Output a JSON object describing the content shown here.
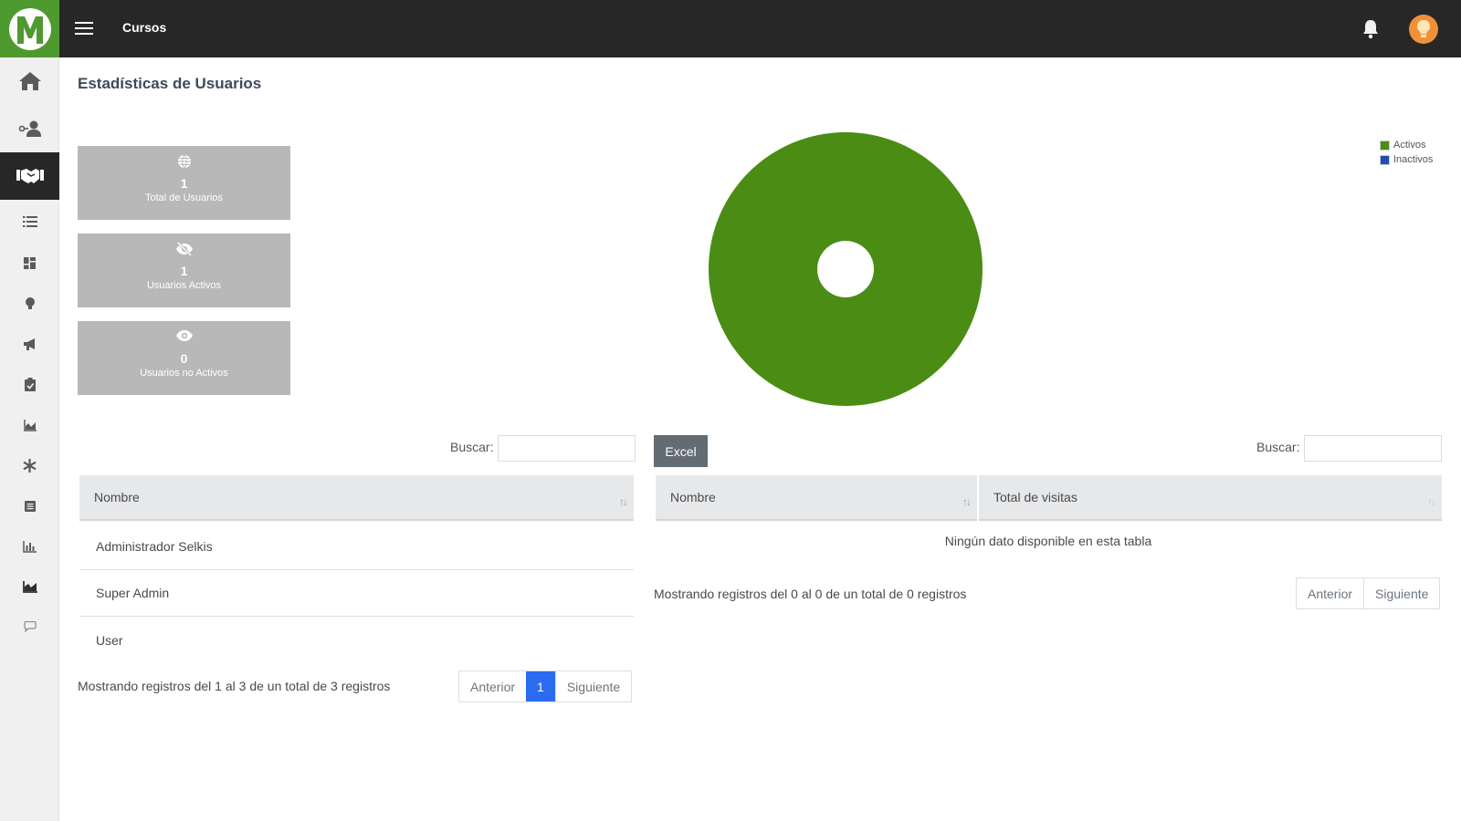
{
  "header": {
    "title": "Cursos",
    "logo_letter": "M"
  },
  "sidebar": {
    "items": [
      {
        "icon": "home-icon"
      },
      {
        "icon": "user-key-icon"
      },
      {
        "icon": "handshake-icon",
        "active": true
      },
      {
        "icon": "list-icon"
      },
      {
        "icon": "dashboard-icon"
      },
      {
        "icon": "lightbulb-icon"
      },
      {
        "icon": "megaphone-icon"
      },
      {
        "icon": "clipboard-check-icon"
      },
      {
        "icon": "area-chart-small-icon"
      },
      {
        "icon": "asterisk-icon"
      },
      {
        "icon": "document-icon"
      },
      {
        "icon": "bar-chart-icon"
      },
      {
        "icon": "area-chart-icon"
      },
      {
        "icon": "comment-icon"
      }
    ]
  },
  "page": {
    "title": "Estadísticas de Usuarios"
  },
  "stats": [
    {
      "icon": "globe-icon",
      "value": "1",
      "label": "Total de Usuarios"
    },
    {
      "icon": "eye-slash-icon",
      "value": "1",
      "label": "Usuarios Activos"
    },
    {
      "icon": "eye-icon",
      "value": "0",
      "label": "Usuarios no Activos"
    }
  ],
  "chart_data": {
    "type": "pie",
    "categories": [
      "Activos",
      "Inactivos"
    ],
    "values": [
      1,
      0
    ],
    "colors": [
      "#4a8c14",
      "#1f4fb5"
    ],
    "legend_position": "top-right"
  },
  "left_table": {
    "search_label": "Buscar:",
    "search_value": "",
    "columns": [
      "Nombre"
    ],
    "rows": [
      "Administrador Selkis",
      "Super Admin",
      "User"
    ],
    "info": "Mostrando registros del 1 al 3 de un total de 3 registros",
    "pager": {
      "prev": "Anterior",
      "current": "1",
      "next": "Siguiente"
    }
  },
  "right_table": {
    "export_label": "Excel",
    "search_label": "Buscar:",
    "search_value": "",
    "columns": [
      "Nombre",
      "Total de visitas"
    ],
    "empty_message": "Ningún dato disponible en esta tabla",
    "info": "Mostrando registros del 0 al 0 de un total de 0 registros",
    "pager": {
      "prev": "Anterior",
      "next": "Siguiente"
    }
  },
  "colors": {
    "topbar": "#272727",
    "brand_green": "#4e9a2f",
    "card_bg": "#b8b8b8",
    "pager_active": "#2a6bf2"
  }
}
